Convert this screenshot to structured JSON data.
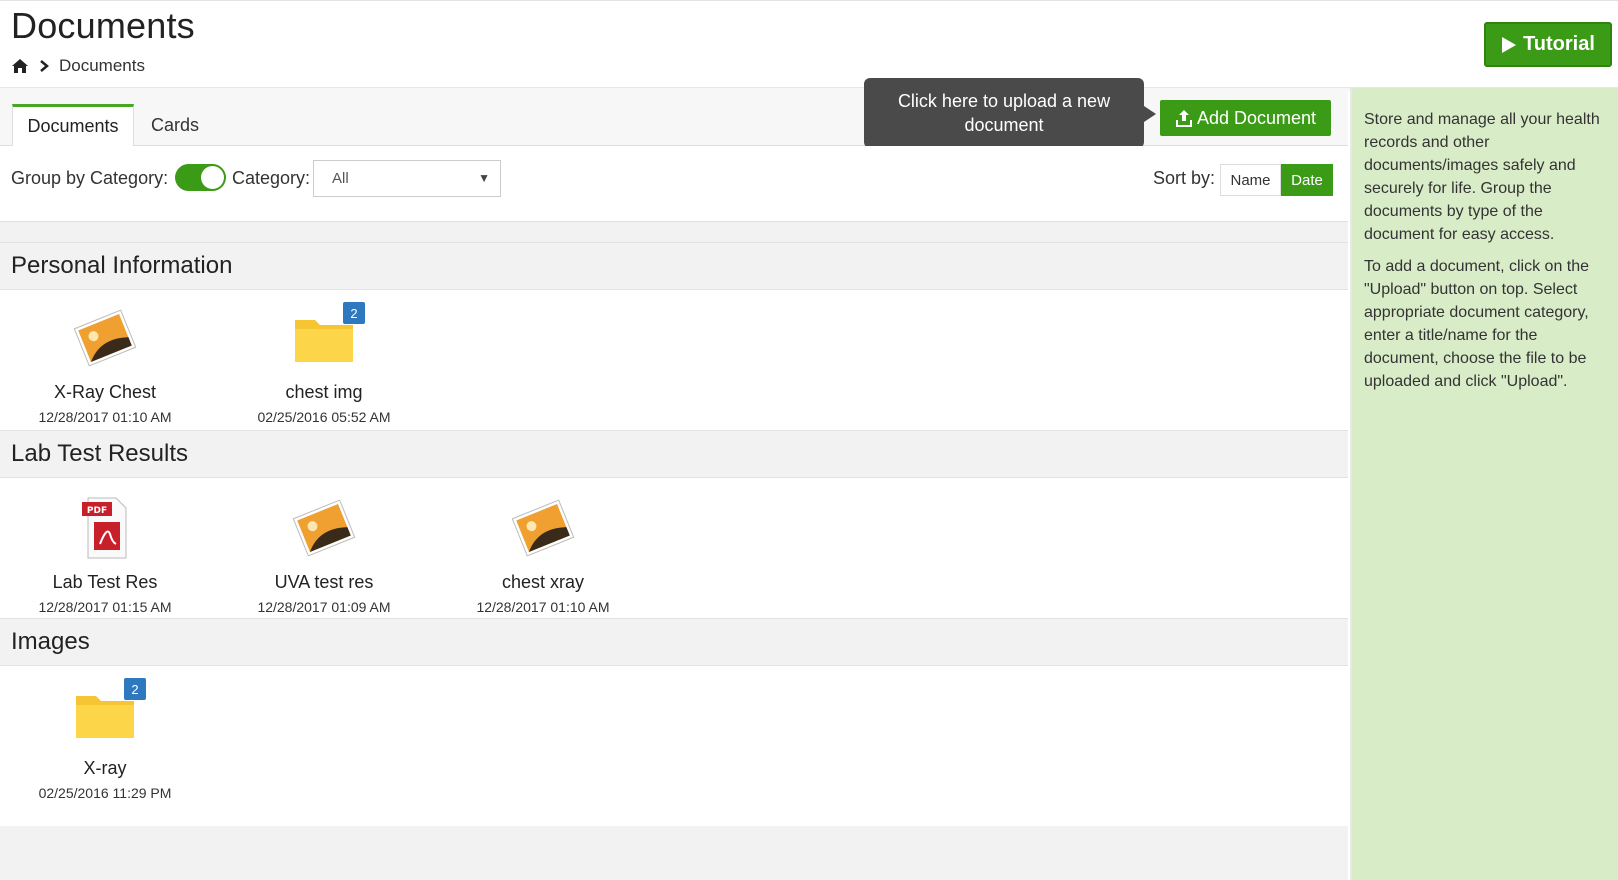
{
  "header": {
    "title": "Documents",
    "breadcrumb": [
      "Documents"
    ],
    "tutorial_label": "Tutorial"
  },
  "tabs": [
    {
      "label": "Documents",
      "active": true
    },
    {
      "label": "Cards",
      "active": false
    }
  ],
  "tooltip": "Click here to upload a new document",
  "add_document_label": "Add Document",
  "filters": {
    "group_by_label": "Group by Category:",
    "group_by_enabled": true,
    "category_label": "Category:",
    "category_value": "All",
    "sort_label": "Sort by:",
    "sort_options": [
      "Name",
      "Date"
    ],
    "sort_selected": "Date"
  },
  "sections": [
    {
      "title": "Personal Information",
      "items": [
        {
          "name": "X-Ray Chest",
          "date": "12/28/2017 01:10 AM",
          "type": "image"
        },
        {
          "name": "chest img",
          "date": "02/25/2016 05:52 AM",
          "type": "folder",
          "count": "2"
        }
      ]
    },
    {
      "title": "Lab Test Results",
      "items": [
        {
          "name": "Lab Test Res",
          "date": "12/28/2017 01:15 AM",
          "type": "pdf"
        },
        {
          "name": "UVA test res",
          "date": "12/28/2017 01:09 AM",
          "type": "image"
        },
        {
          "name": "chest xray",
          "date": "12/28/2017 01:10 AM",
          "type": "image"
        }
      ]
    },
    {
      "title": "Images",
      "items": [
        {
          "name": "X-ray",
          "date": "02/25/2016 11:29 PM",
          "type": "folder",
          "count": "2"
        }
      ]
    }
  ],
  "pdf_label": "PDF",
  "side_panel": {
    "paragraphs": [
      "Store and manage all your health records and other documents/images safely and securely for life. Group the documents by type of the document for easy access.",
      "To add a document, click on the \"Upload\" button on top. Select appropriate document category, enter a title/name for the document, choose the file to be uploaded and click \"Upload\"."
    ]
  },
  "colors": {
    "accent_green": "#3c9b16",
    "badge_blue": "#2e78c0",
    "side_panel_bg": "#d9ecc8",
    "tooltip_bg": "#4a4a4a"
  }
}
